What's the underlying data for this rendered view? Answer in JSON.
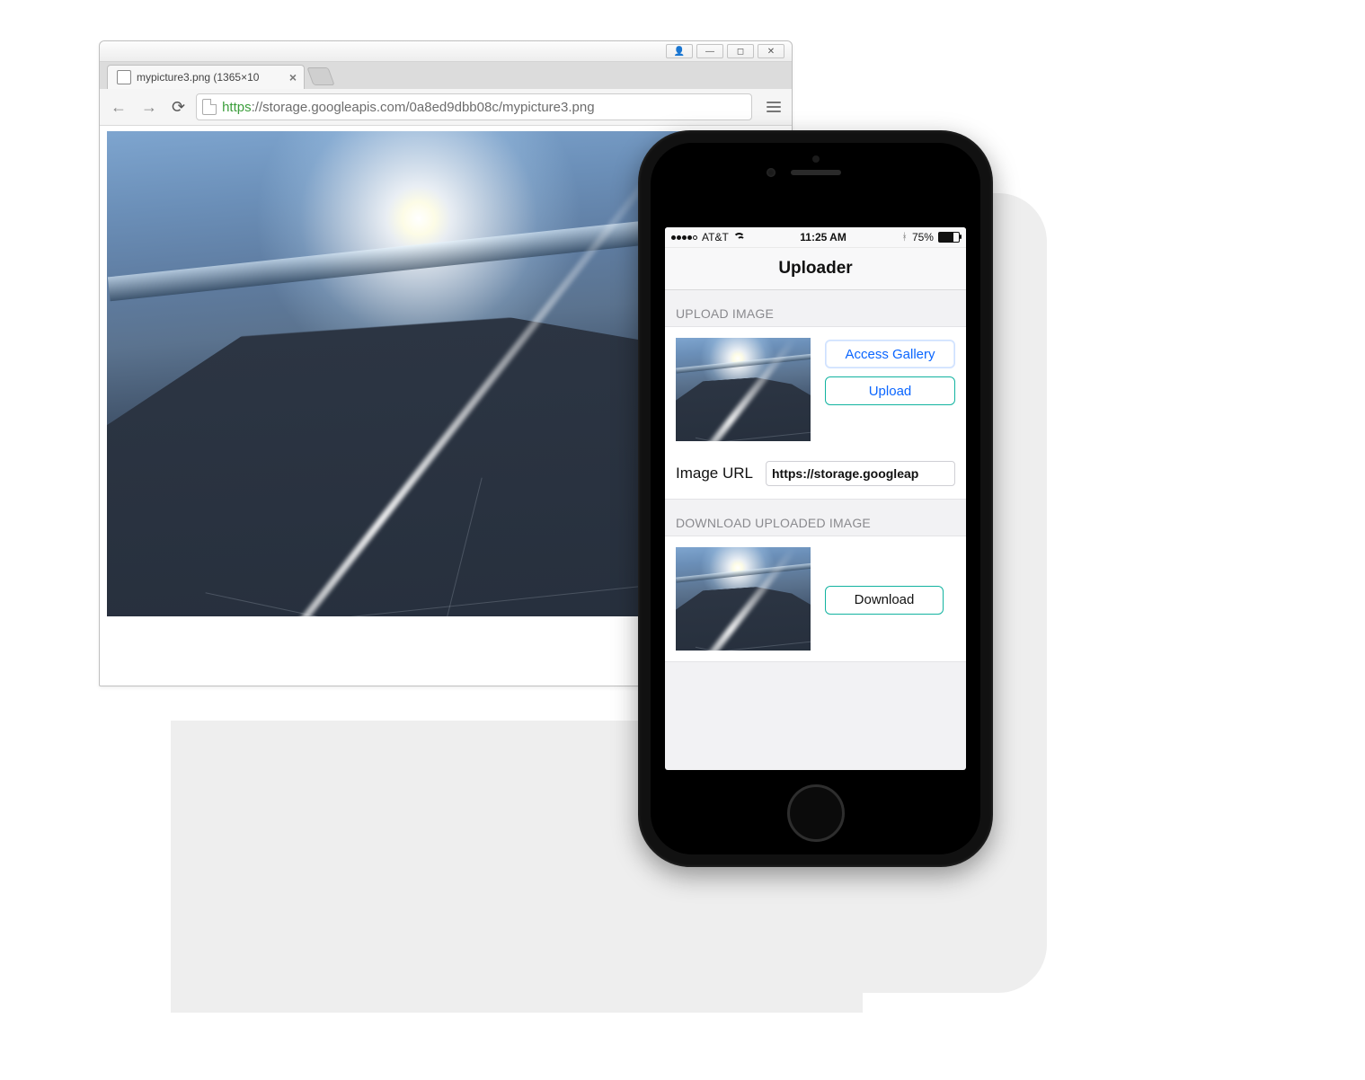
{
  "browser": {
    "tab_title": "mypicture3.png (1365×10",
    "url_scheme": "https",
    "url_rest": "://storage.googleapis.com/0a8ed9dbb08c/mypicture3.png",
    "win_user": "👤",
    "win_min": "—",
    "win_max": "◻",
    "win_close": "✕"
  },
  "phone": {
    "status": {
      "carrier": "AT&T",
      "time": "11:25 AM",
      "battery_pct": "75%"
    },
    "nav_title": "Uploader",
    "section_upload": "UPLOAD IMAGE",
    "section_download": "DOWNLOAD UPLOADED IMAGE",
    "btn_gallery": "Access Gallery",
    "btn_upload": "Upload",
    "btn_download": "Download",
    "url_label": "Image URL",
    "url_value": "https://storage.googleap"
  }
}
